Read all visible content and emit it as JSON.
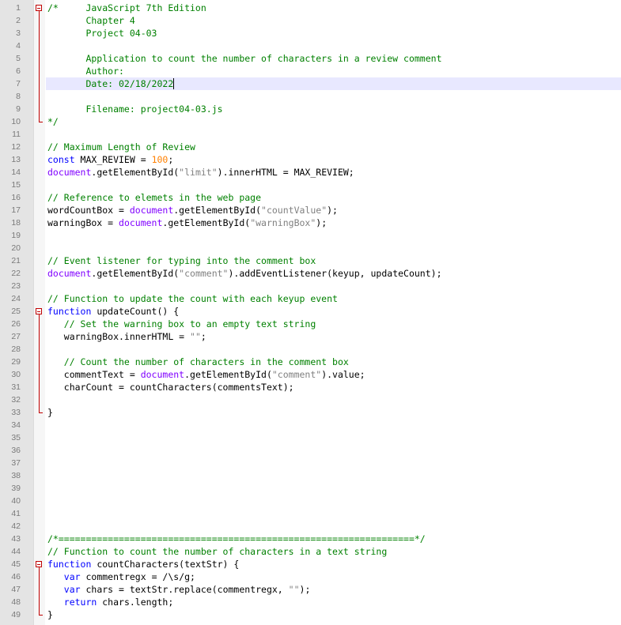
{
  "editor": {
    "current_line": 7,
    "colors": {
      "comment": "#008000",
      "keyword": "#0000ff",
      "document_object": "#8000ff",
      "string": "#808080",
      "number": "#ff8000",
      "fold_marker": "#c00000",
      "current_line_highlight": "#e8e8ff"
    },
    "fold_regions": [
      {
        "start": 1,
        "end": 10
      },
      {
        "start": 25,
        "end": 33
      },
      {
        "start": 45,
        "end": 49
      }
    ],
    "lines": [
      {
        "n": "1",
        "tokens": [
          {
            "t": "comment",
            "v": "/*     JavaScript 7th Edition"
          }
        ]
      },
      {
        "n": "2",
        "tokens": [
          {
            "t": "comment",
            "v": "       Chapter 4"
          }
        ]
      },
      {
        "n": "3",
        "tokens": [
          {
            "t": "comment",
            "v": "       Project 04-03"
          }
        ]
      },
      {
        "n": "4",
        "tokens": []
      },
      {
        "n": "5",
        "tokens": [
          {
            "t": "comment",
            "v": "       Application to count the number of characters in a review comment"
          }
        ]
      },
      {
        "n": "6",
        "tokens": [
          {
            "t": "comment",
            "v": "       Author:"
          }
        ]
      },
      {
        "n": "7",
        "tokens": [
          {
            "t": "comment",
            "v": "       Date: 02/18/2022"
          }
        ]
      },
      {
        "n": "8",
        "tokens": []
      },
      {
        "n": "9",
        "tokens": [
          {
            "t": "comment",
            "v": "       Filename: project04-03.js"
          }
        ]
      },
      {
        "n": "10",
        "tokens": [
          {
            "t": "comment",
            "v": "*/"
          }
        ]
      },
      {
        "n": "11",
        "tokens": []
      },
      {
        "n": "12",
        "tokens": [
          {
            "t": "comment",
            "v": "// Maximum Length of Review"
          }
        ]
      },
      {
        "n": "13",
        "tokens": [
          {
            "t": "keyword",
            "v": "const"
          },
          {
            "t": "plain",
            "v": " MAX_REVIEW = "
          },
          {
            "t": "number",
            "v": "100"
          },
          {
            "t": "plain",
            "v": ";"
          }
        ]
      },
      {
        "n": "14",
        "tokens": [
          {
            "t": "document",
            "v": "document"
          },
          {
            "t": "plain",
            "v": ".getElementById("
          },
          {
            "t": "string",
            "v": "\"limit\""
          },
          {
            "t": "plain",
            "v": ").innerHTML = MAX_REVIEW;"
          }
        ]
      },
      {
        "n": "15",
        "tokens": []
      },
      {
        "n": "16",
        "tokens": [
          {
            "t": "comment",
            "v": "// Reference to elemets in the web page"
          }
        ]
      },
      {
        "n": "17",
        "tokens": [
          {
            "t": "plain",
            "v": "wordCountBox = "
          },
          {
            "t": "document",
            "v": "document"
          },
          {
            "t": "plain",
            "v": ".getElementById("
          },
          {
            "t": "string",
            "v": "\"countValue\""
          },
          {
            "t": "plain",
            "v": ");"
          }
        ]
      },
      {
        "n": "18",
        "tokens": [
          {
            "t": "plain",
            "v": "warningBox = "
          },
          {
            "t": "document",
            "v": "document"
          },
          {
            "t": "plain",
            "v": ".getElementById("
          },
          {
            "t": "string",
            "v": "\"warningBox\""
          },
          {
            "t": "plain",
            "v": ");"
          }
        ]
      },
      {
        "n": "19",
        "tokens": []
      },
      {
        "n": "20",
        "tokens": []
      },
      {
        "n": "21",
        "tokens": [
          {
            "t": "comment",
            "v": "// Event listener for typing into the comment box"
          }
        ]
      },
      {
        "n": "22",
        "tokens": [
          {
            "t": "document",
            "v": "document"
          },
          {
            "t": "plain",
            "v": ".getElementById("
          },
          {
            "t": "string",
            "v": "\"comment\""
          },
          {
            "t": "plain",
            "v": ").addEventListener(keyup, updateCount);"
          }
        ]
      },
      {
        "n": "23",
        "tokens": []
      },
      {
        "n": "24",
        "tokens": [
          {
            "t": "comment",
            "v": "// Function to update the count with each keyup event"
          }
        ]
      },
      {
        "n": "25",
        "tokens": [
          {
            "t": "keyword",
            "v": "function"
          },
          {
            "t": "plain",
            "v": " updateCount() {"
          }
        ]
      },
      {
        "n": "26",
        "tokens": [
          {
            "t": "comment",
            "v": "   // Set the warning box to an empty text string"
          }
        ]
      },
      {
        "n": "27",
        "tokens": [
          {
            "t": "plain",
            "v": "   warningBox.innerHTML = "
          },
          {
            "t": "string",
            "v": "\"\""
          },
          {
            "t": "plain",
            "v": ";"
          }
        ]
      },
      {
        "n": "28",
        "tokens": []
      },
      {
        "n": "29",
        "tokens": [
          {
            "t": "comment",
            "v": "   // Count the number of characters in the comment box"
          }
        ]
      },
      {
        "n": "30",
        "tokens": [
          {
            "t": "plain",
            "v": "   commentText = "
          },
          {
            "t": "document",
            "v": "document"
          },
          {
            "t": "plain",
            "v": ".getElementById("
          },
          {
            "t": "string",
            "v": "\"comment\""
          },
          {
            "t": "plain",
            "v": ").value;"
          }
        ]
      },
      {
        "n": "31",
        "tokens": [
          {
            "t": "plain",
            "v": "   charCount = countCharacters(commentsText);"
          }
        ]
      },
      {
        "n": "32",
        "tokens": []
      },
      {
        "n": "33",
        "tokens": [
          {
            "t": "plain",
            "v": "}"
          }
        ]
      },
      {
        "n": "34",
        "tokens": []
      },
      {
        "n": "35",
        "tokens": []
      },
      {
        "n": "36",
        "tokens": []
      },
      {
        "n": "37",
        "tokens": []
      },
      {
        "n": "38",
        "tokens": []
      },
      {
        "n": "39",
        "tokens": []
      },
      {
        "n": "40",
        "tokens": []
      },
      {
        "n": "41",
        "tokens": []
      },
      {
        "n": "42",
        "tokens": []
      },
      {
        "n": "43",
        "tokens": [
          {
            "t": "comment",
            "v": "/*=================================================================*/"
          }
        ]
      },
      {
        "n": "44",
        "tokens": [
          {
            "t": "comment",
            "v": "// Function to count the number of characters in a text string"
          }
        ]
      },
      {
        "n": "45",
        "tokens": [
          {
            "t": "keyword",
            "v": "function"
          },
          {
            "t": "plain",
            "v": " countCharacters(textStr) {"
          }
        ]
      },
      {
        "n": "46",
        "tokens": [
          {
            "t": "plain",
            "v": "   "
          },
          {
            "t": "keyword",
            "v": "var"
          },
          {
            "t": "plain",
            "v": " commentregx = "
          },
          {
            "t": "regex",
            "v": "/\\s/g"
          },
          {
            "t": "plain",
            "v": ";"
          }
        ]
      },
      {
        "n": "47",
        "tokens": [
          {
            "t": "plain",
            "v": "   "
          },
          {
            "t": "keyword",
            "v": "var"
          },
          {
            "t": "plain",
            "v": " chars = textStr.replace(commentregx, "
          },
          {
            "t": "string",
            "v": "\"\""
          },
          {
            "t": "plain",
            "v": ");"
          }
        ]
      },
      {
        "n": "48",
        "tokens": [
          {
            "t": "plain",
            "v": "   "
          },
          {
            "t": "keyword",
            "v": "return"
          },
          {
            "t": "plain",
            "v": " chars.length;"
          }
        ]
      },
      {
        "n": "49",
        "tokens": [
          {
            "t": "plain",
            "v": "}"
          }
        ]
      }
    ]
  }
}
